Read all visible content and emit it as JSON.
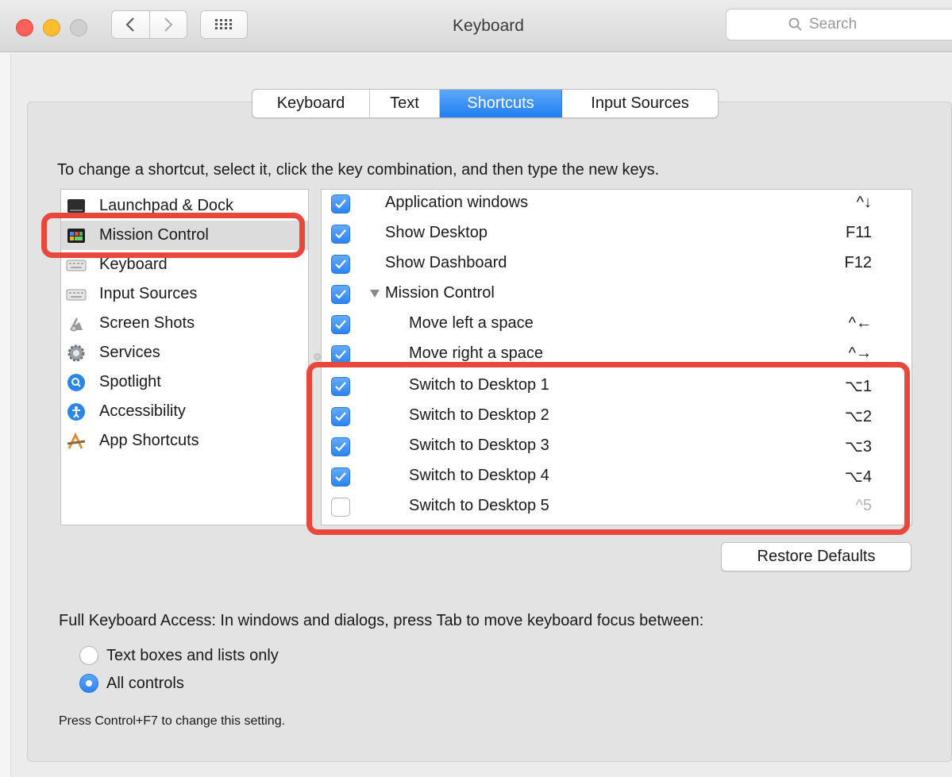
{
  "window": {
    "title": "Keyboard",
    "search_placeholder": "Search"
  },
  "tabs": [
    {
      "label": "Keyboard",
      "active": false
    },
    {
      "label": "Text",
      "active": false
    },
    {
      "label": "Shortcuts",
      "active": true
    },
    {
      "label": "Input Sources",
      "active": false
    }
  ],
  "instruction": "To change a shortcut, select it, click the key combination, and then type the new keys.",
  "categories": [
    {
      "label": "Launchpad & Dock",
      "icon": "launchpad-dock-icon",
      "selected": false
    },
    {
      "label": "Mission Control",
      "icon": "mission-control-icon",
      "selected": true
    },
    {
      "label": "Keyboard",
      "icon": "keyboard-icon",
      "selected": false
    },
    {
      "label": "Input Sources",
      "icon": "input-sources-icon",
      "selected": false
    },
    {
      "label": "Screen Shots",
      "icon": "screen-shots-icon",
      "selected": false
    },
    {
      "label": "Services",
      "icon": "gear-icon",
      "selected": false
    },
    {
      "label": "Spotlight",
      "icon": "spotlight-icon",
      "selected": false
    },
    {
      "label": "Accessibility",
      "icon": "accessibility-icon",
      "selected": false
    },
    {
      "label": "App Shortcuts",
      "icon": "app-shortcuts-icon",
      "selected": false
    }
  ],
  "shortcuts": [
    {
      "label": "Application windows",
      "key": "^↓",
      "checked": true
    },
    {
      "label": "Show Desktop",
      "key": "F11",
      "checked": true
    },
    {
      "label": "Show Dashboard",
      "key": "F12",
      "checked": true
    },
    {
      "label": "Mission Control",
      "key": "",
      "checked": true
    },
    {
      "label": "Move left a space",
      "key": "^←",
      "checked": true
    },
    {
      "label": "Move right a space",
      "key": "^→",
      "checked": true
    },
    {
      "label": "Switch to Desktop 1",
      "key": "⌥1",
      "checked": true
    },
    {
      "label": "Switch to Desktop 2",
      "key": "⌥2",
      "checked": true
    },
    {
      "label": "Switch to Desktop 3",
      "key": "⌥3",
      "checked": true
    },
    {
      "label": "Switch to Desktop 4",
      "key": "⌥4",
      "checked": true
    },
    {
      "label": "Switch to Desktop 5",
      "key": "^5",
      "checked": false
    }
  ],
  "restore_defaults": "Restore Defaults",
  "full_keyboard_access": {
    "label": "Full Keyboard Access: In windows and dialogs, press Tab to move keyboard focus between:",
    "options": [
      {
        "label": "Text boxes and lists only",
        "selected": false
      },
      {
        "label": "All controls",
        "selected": true
      }
    ],
    "note": "Press Control+F7 to change this setting."
  },
  "colors": {
    "accent_blue": "#2b84f3",
    "highlight_red": "#e8473b"
  }
}
